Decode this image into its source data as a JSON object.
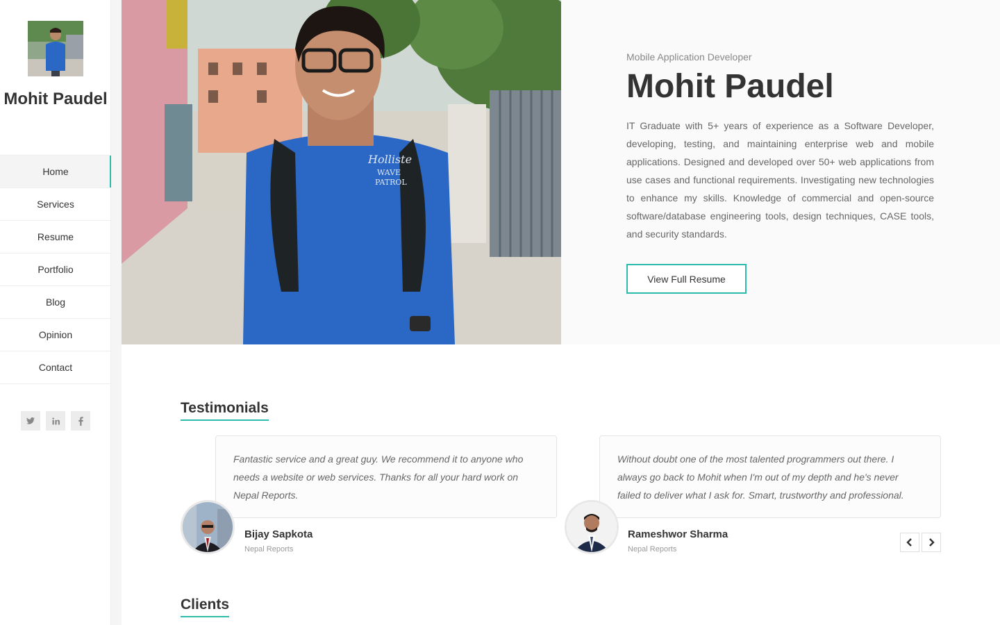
{
  "sidebar": {
    "name": "Mohit Paudel",
    "nav": [
      {
        "label": "Home",
        "active": true
      },
      {
        "label": "Services"
      },
      {
        "label": "Resume"
      },
      {
        "label": "Portfolio"
      },
      {
        "label": "Blog"
      },
      {
        "label": "Opinion"
      },
      {
        "label": "Contact"
      }
    ],
    "social": [
      "twitter-icon",
      "linkedin-icon",
      "facebook-icon"
    ]
  },
  "hero": {
    "role": "Mobile Application Developer",
    "name": "Mohit Paudel",
    "description": "IT Graduate with 5+ years of experience as a Software Developer, developing, testing, and maintaining enterprise web and mobile applications. Designed and developed over 50+ web applications from use cases and functional requirements. Investigating new technologies to enhance my skills. Knowledge of commercial and open-source software/database engineering tools, design techniques, CASE tools, and security standards.",
    "button": "View Full Resume"
  },
  "testimonials": {
    "title": "Testimonials",
    "items": [
      {
        "quote": "Fantastic service and a great guy. We recommend it to anyone who needs a website or web services. Thanks for all your hard work on Nepal Reports.",
        "name": "Bijay Sapkota",
        "org": "Nepal Reports"
      },
      {
        "quote": "Without doubt one of the most talented programmers out there. I always go back to Mohit when I'm out of my depth and he's never failed to deliver what I ask for. Smart, trustworthy and professional.",
        "name": "Rameshwor Sharma",
        "org": "Nepal Reports"
      }
    ]
  },
  "clients": {
    "title": "Clients"
  },
  "colors": {
    "accent": "#2bbbad",
    "shirt": "#2b67c4"
  }
}
